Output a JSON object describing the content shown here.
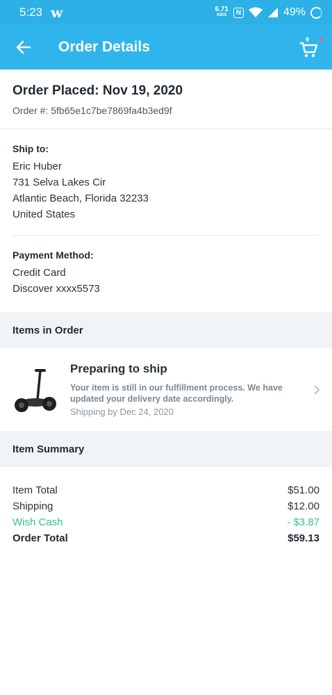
{
  "status_bar": {
    "time": "5:23",
    "wish_glyph": "w",
    "net_speed_value": "6.71",
    "net_speed_unit": "KB/S",
    "nfc": "N",
    "battery": "49%"
  },
  "app_bar": {
    "title": "Order Details",
    "cart_count": "9"
  },
  "order": {
    "placed": "Order Placed: Nov 19, 2020",
    "number": "Order #: 5fb65e1c7be7869fa4b3ed9f"
  },
  "ship_to": {
    "label": "Ship to:",
    "lines": [
      "Eric Huber",
      "731 Selva Lakes Cir",
      "Atlantic Beach, Florida 32233",
      "United States"
    ]
  },
  "payment": {
    "label": "Payment Method:",
    "lines": [
      "Credit Card",
      "Discover xxxx5573"
    ]
  },
  "items_header": "Items in Order",
  "item": {
    "status": "Preparing to ship",
    "description": "Your item is still in our fulfillment process. We have updated your delivery date accordingly.",
    "shipping": "Shipping by Dec 24, 2020"
  },
  "summary_header": "Item Summary",
  "summary": {
    "item_total_label": "Item Total",
    "item_total_value": "$51.00",
    "shipping_label": "Shipping",
    "shipping_value": "$12.00",
    "wish_cash_label": "Wish Cash",
    "wish_cash_value": "- $3.87",
    "order_total_label": "Order Total",
    "order_total_value": "$59.13"
  },
  "colors": {
    "app_bar": "#2fb5ec",
    "wish_cash": "#36c08e"
  },
  "icons": {
    "back": "arrow-left-icon",
    "cart": "cart-icon",
    "chevron": "chevron-right-icon"
  }
}
